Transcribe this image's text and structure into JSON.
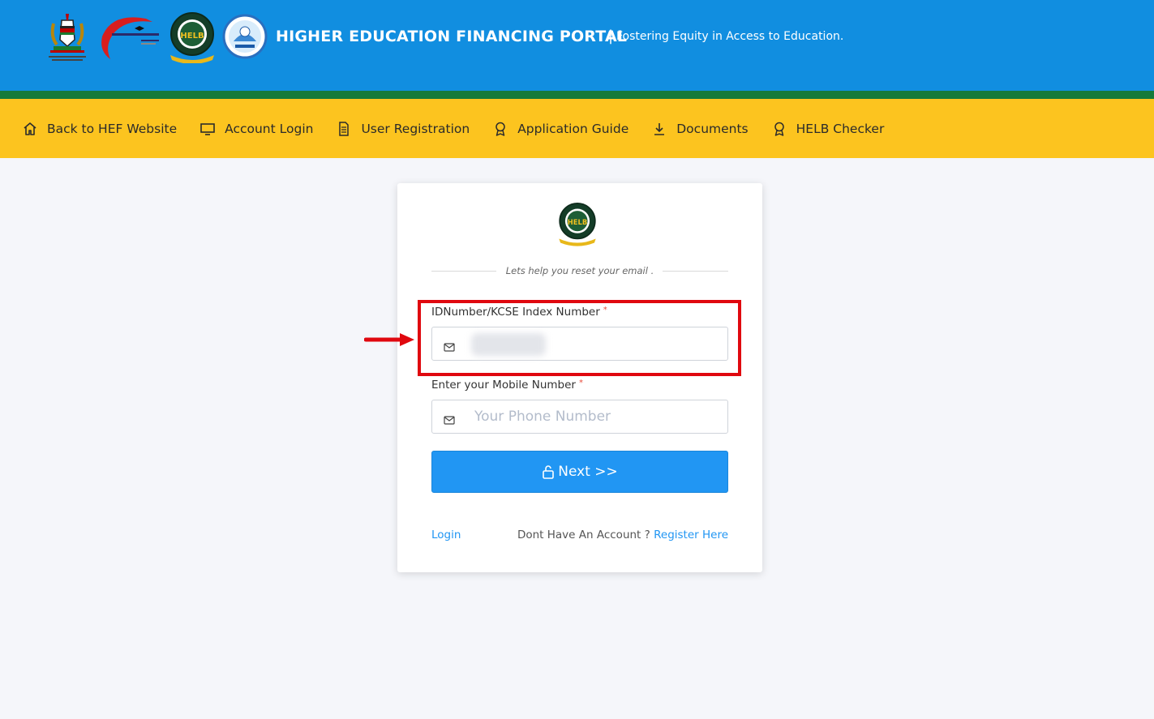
{
  "header": {
    "title": "HIGHER EDUCATION FINANCING PORTAL",
    "separator": "|",
    "tagline": "Fostering Equity in Access to Education.",
    "logos": [
      "kenya-coat-of-arms",
      "hef-logo",
      "helb-logo",
      "kuccps-logo"
    ],
    "colors": {
      "header": "#118ee0",
      "strip": "#157a3a",
      "nav": "#fcc41f"
    }
  },
  "nav": {
    "items": [
      {
        "label": "Back to HEF Website",
        "icon": "home-icon"
      },
      {
        "label": "Account Login",
        "icon": "monitor-icon"
      },
      {
        "label": "User Registration",
        "icon": "document-icon"
      },
      {
        "label": "Application Guide",
        "icon": "award-icon"
      },
      {
        "label": "Documents",
        "icon": "download-icon"
      },
      {
        "label": "HELB Checker",
        "icon": "award-icon"
      }
    ]
  },
  "form": {
    "subtitle": "Lets help you reset your email .",
    "id_field": {
      "label": "IDNumber/KCSE Index Number",
      "required": "*",
      "value": "",
      "placeholder": ""
    },
    "phone_field": {
      "label": "Enter your Mobile Number",
      "required": "*",
      "value": "",
      "placeholder": "Your Phone Number"
    },
    "next_button": "Next >>",
    "login_link": "Login",
    "account_prompt": "Dont Have An Account ?",
    "register_link": "Register Here"
  },
  "annotation": {
    "color": "#e0080f"
  }
}
